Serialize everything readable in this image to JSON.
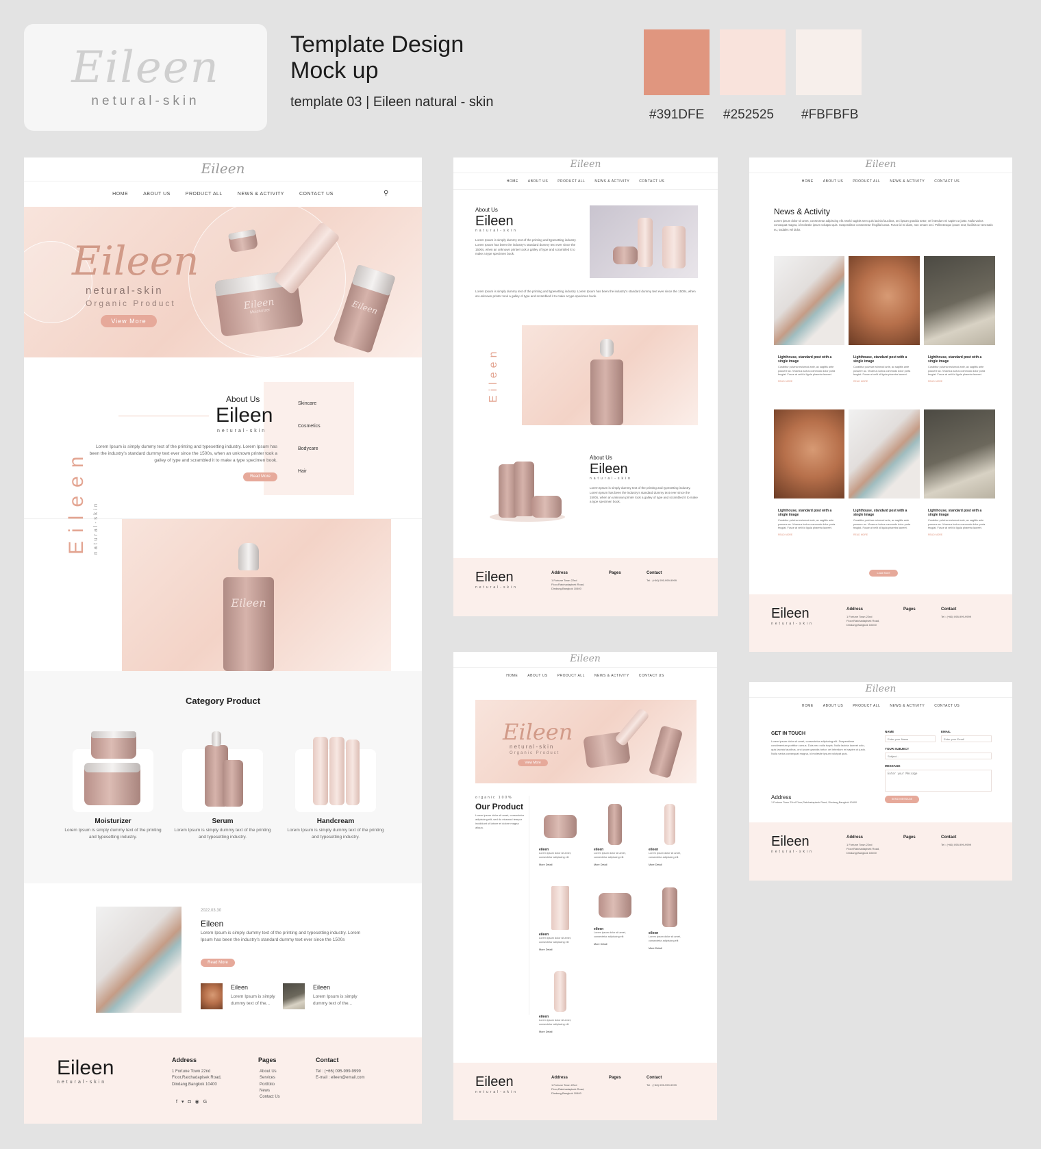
{
  "header": {
    "logo_script": "Eileen",
    "logo_sub": "netural-skin",
    "title_line1": "Template Design",
    "title_line2": "Mock up",
    "subtitle": "template 03  | Eileen natural - skin"
  },
  "palette": [
    {
      "hex": "#391DFE",
      "color": "#e0967f"
    },
    {
      "hex": "#252525",
      "color": "#f9e3dc"
    },
    {
      "hex": "#FBFBFB",
      "color": "#f7efeb"
    }
  ],
  "nav": [
    "HOME",
    "ABOUT US",
    "PRODUCT ALL",
    "NEWS & ACTIVITY",
    "CONTACT US"
  ],
  "brand": {
    "name": "Eileen",
    "sub": "netural-skin",
    "sub_small": "natural-skin"
  },
  "hero": {
    "line1": "netural-skin",
    "line2": "Organic Product",
    "button": "View More",
    "product_label": "Moisturizer"
  },
  "about": {
    "heading": "About Us",
    "text": "Lorem Ipsum is simply dummy text of the printing and typesetting industry. Lorem Ipsum has been the industry's standard dummy text ever since the 1500s, when an unknown printer took a galley of type and scrambled it to make a type specimen book.",
    "button": "Read More",
    "side_items": [
      "Skincare",
      "Cosmetics",
      "Bodycare",
      "Hair"
    ]
  },
  "category": {
    "title": "Category Product",
    "items": [
      {
        "name": "Moisturizer",
        "desc": "Lorem Ipsum is simply dummy text of the printing and typesetting industry."
      },
      {
        "name": "Serum",
        "desc": "Lorem Ipsum is simply dummy text of the printing and typesetting industry."
      },
      {
        "name": "Handcream",
        "desc": "Lorem Ipsum is simply dummy text of the printing and typesetting industry."
      }
    ]
  },
  "blog": {
    "date": "2022.03.30",
    "title": "Eileen",
    "text": "Lorem Ipsum is simply dummy text of the printing and typesetting industry. Lorem Ipsum has been the industry's standard dummy text ever since the 1500s",
    "button": "Read More",
    "mini": [
      {
        "title": "Eileen",
        "text": "Lorem Ipsum is simply dummy text of the..."
      },
      {
        "title": "Eileen",
        "text": "Lorem Ipsum is simply dummy text of the..."
      }
    ]
  },
  "footer": {
    "address_h": "Address",
    "address": "1 Fortune Town 22nd Floor,Ratchadapisek Road, Dindang,Bangkok 10400",
    "pages_h": "Pages",
    "pages": [
      "About Us",
      "Services",
      "Portfolio",
      "News",
      "Contact Us"
    ],
    "contact_h": "Contact",
    "tel": "Tel : (+66) 095-999-9999",
    "email": "E-mail : eileen@email.com"
  },
  "news": {
    "title": "News & Activity",
    "intro": "Lorem ipsum dolor sit amet, consectetur adipiscing elit. Morbi sagittis sem quis lacinia faucibus, orci ipsum gravida tortor, vel interdum mi sapien ut justo. Nulla varius consequat magna, id molestie ipsum volutpat quis. Suspendisse consectetur fringilla luctus. Fusce id mi diam, non ornare orci. Pellentesque ipsum erat, facilisis ut venenatis eu, sodales vel dolor.",
    "card_title": "Lighthouse, standard post with a single image",
    "card_text": "Curabitur pulvinar euismod ante, ac sagittis ante posuere ac. Vivamus luctus commodo dolor porta feugiat. Fusce at velit id ligula pharetra laoreet.",
    "read_more": "READ MORE",
    "load_more": "Load More"
  },
  "product": {
    "tag": "organic 100%",
    "title": "Our Product",
    "text": "Lorem ipsum dolor sit amet, consectetur adipiscing elit, sed do eiusmod tempor incididunt ut labore et dolore magna aliqua.",
    "item_name": "eileen",
    "item_text": "Lorem ipsum dolor sit amet, consectetur adipiscing elit",
    "more": "More Detail"
  },
  "contact": {
    "title": "GET IN TOUCH",
    "text": "Lorem ipsum dolor sit amet, consectetur adipiscing elit. Suspendisse condimentum porttitor cursus. Duis nec nulla turpis. Nulla lacinia laoreet odio, quis lacinia faucibus, orci ipsum gravida tortor, vel interdum mi sapien ut justo. Nulla varius consequat magna, id molestie ipsum volutpat quis.",
    "name_label": "NAME",
    "name_ph": "Enter your Name",
    "email_label": "EMAIL",
    "email_ph": "Enter your Email",
    "subject_label": "YOUR SUBJECT",
    "subject_ph": "Subject...",
    "message_label": "MESSAGE",
    "message_ph": "Enter your Message",
    "address_h": "Address",
    "address": "1 Fortune Town 22nd Floor,Ratchadapisek Road, Dindang,Bangkok 10400",
    "send": "SEND MESSAGE"
  }
}
